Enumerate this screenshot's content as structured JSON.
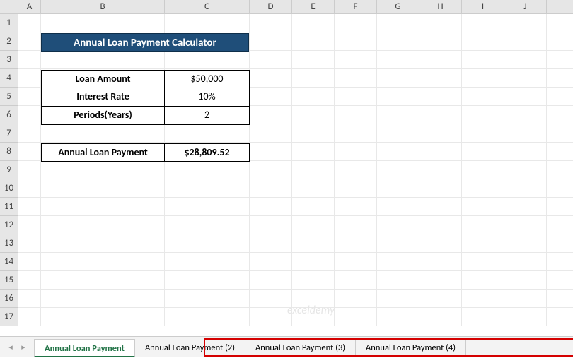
{
  "columns": [
    "A",
    "B",
    "C",
    "D",
    "E",
    "F",
    "G",
    "H",
    "I",
    "J"
  ],
  "rows": [
    "1",
    "2",
    "3",
    "4",
    "5",
    "6",
    "7",
    "8",
    "9",
    "10",
    "11",
    "12",
    "13",
    "14",
    "15",
    "16",
    "17"
  ],
  "banner": {
    "title": "Annual Loan Payment Calculator"
  },
  "table": {
    "r1": {
      "label": "Loan Amount",
      "value": "$50,000"
    },
    "r2": {
      "label": "Interest Rate",
      "value": "10%"
    },
    "r3": {
      "label": "Periods(Years)",
      "value": "2"
    }
  },
  "result": {
    "label": "Annual Loan Payment",
    "value": "$28,809.52"
  },
  "watermark": "exceldemy",
  "tabs": {
    "t0": "Annual Loan Payment",
    "t1": "Annual Loan Payment (2)",
    "t2": "Annual Loan Payment (3)",
    "t3": "Annual Loan Payment (4)"
  },
  "nav": {
    "prev": "◂",
    "next": "▸"
  }
}
